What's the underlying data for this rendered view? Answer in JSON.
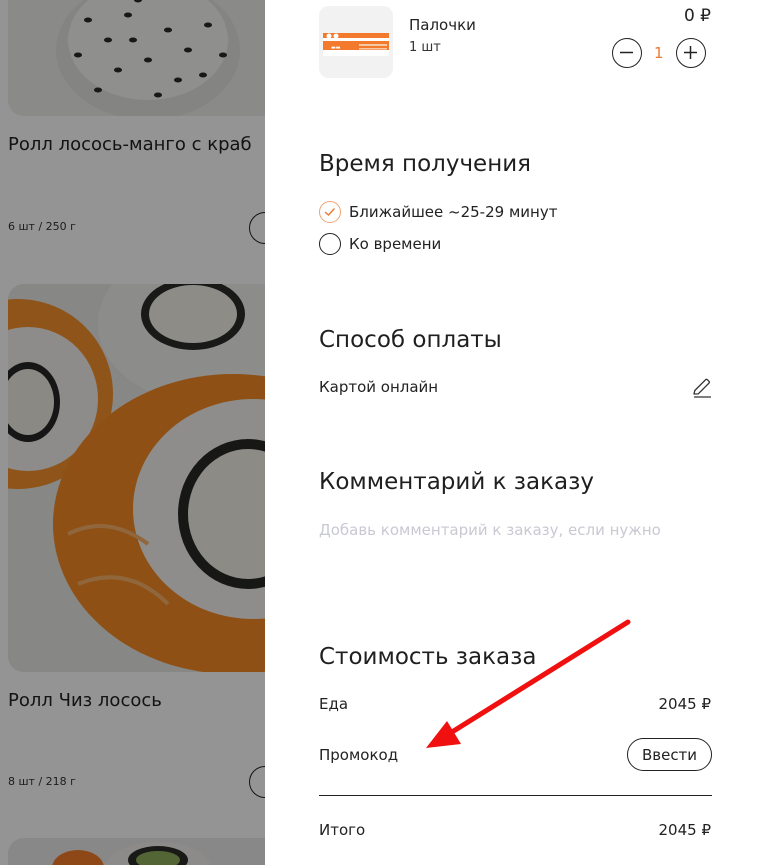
{
  "menu": {
    "products": [
      {
        "title": "Ролл лосось-манго с краб",
        "meta": "6 шт / 250 г"
      },
      {
        "title": "Ролл Чиз лосось",
        "meta": "8 шт / 218 г"
      }
    ]
  },
  "cart": {
    "item": {
      "name": "Палочки",
      "quantity_label": "1 шт",
      "price": "0 ₽",
      "quantity": "1",
      "thumb_icon": "chopsticks-icon"
    },
    "pickup_time": {
      "title": "Время получения",
      "options": [
        {
          "label": "Ближайшее ~25-29 минут",
          "selected": true
        },
        {
          "label": "Ко времени",
          "selected": false
        }
      ]
    },
    "payment": {
      "title": "Способ оплаты",
      "method": "Картой онлайн",
      "edit_icon": "pencil-icon"
    },
    "comment": {
      "title": "Комментарий к заказу",
      "placeholder": "Добавь комментарий к заказу, если нужно",
      "value": ""
    },
    "order_cost": {
      "title": "Стоимость заказа",
      "food_label": "Еда",
      "food_value": "2045 ₽",
      "promo_label": "Промокод",
      "promo_button": "Ввести",
      "total_label": "Итого",
      "total_value": "2045 ₽"
    }
  },
  "colors": {
    "accent": "#ec7a35",
    "radio_checked": "#f0a572",
    "placeholder": "#c9c9d3",
    "annotation_arrow": "#f01010"
  }
}
